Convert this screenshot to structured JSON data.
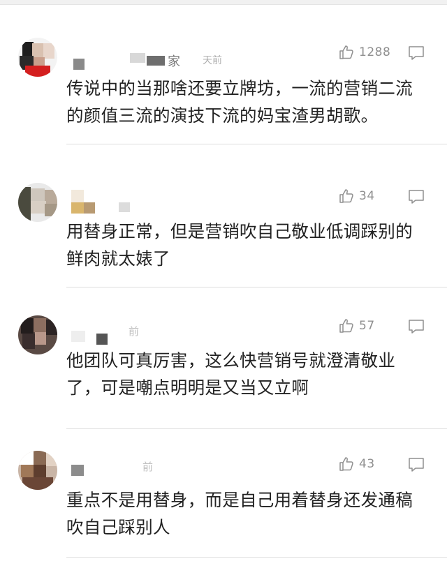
{
  "comments": [
    {
      "name_tail": "家",
      "time": "天前",
      "likes": "1288",
      "line1": "传说中的当那啥还要立牌坊，一流的营销二流",
      "line2": "的颜值三流的演技下流的妈宝渣男胡歌。"
    },
    {
      "name_tail": "",
      "time": "",
      "likes": "34",
      "line1": "用替身正常，但是营销吹自己敬业低调踩别的",
      "line2": "鲜肉就太婊了"
    },
    {
      "name_tail": "",
      "time": "前",
      "likes": "57",
      "line1": "他团队可真厉害，这么快营销号就澄清敬业",
      "line2": "了，可是嘲点明明是又当又立啊"
    },
    {
      "name_tail": "",
      "time": "前",
      "likes": "43",
      "line1": "重点不是用替身，而是自己用着替身还发通稿",
      "line2": "吹自己踩别人"
    }
  ],
  "icons": {
    "like": "thumbs-up-icon",
    "reply": "comment-bubble-icon"
  },
  "colors": {
    "text": "#222222",
    "meta": "#8f8f8f",
    "divider": "#dedede"
  }
}
